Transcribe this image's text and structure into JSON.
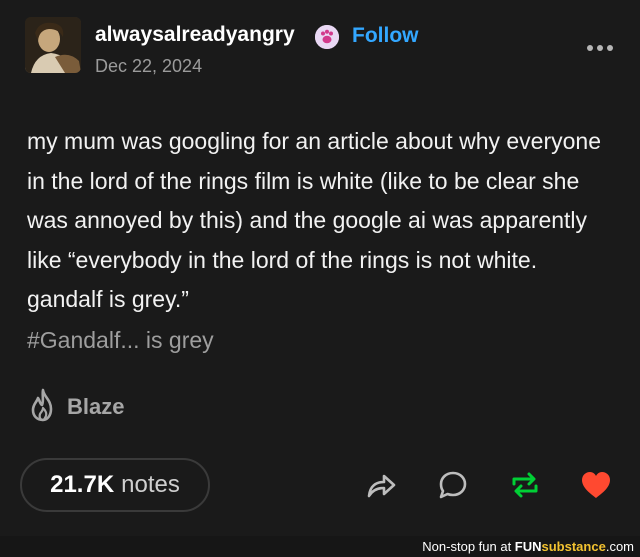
{
  "post": {
    "username": "alwaysalreadyangry",
    "follow_label": "Follow",
    "date": "Dec 22, 2024",
    "body": "my mum was googling for an article about why everyone in the lord of the rings film is white (like to be clear she was annoyed by this) and the google ai was apparently like “everybody in the lord of the rings is not white. gandalf is grey.”",
    "tag": "#Gandalf... is grey",
    "blaze_label": "Blaze",
    "notes_count": "21.7K",
    "notes_label": "notes"
  },
  "icons": {
    "badge": "paw-badge-icon",
    "more": "more-options-icon",
    "blaze": "flame-icon",
    "share": "share-icon",
    "reply": "reply-icon",
    "reblog": "reblog-icon",
    "like": "heart-icon"
  },
  "colors": {
    "follow": "#33a7ff",
    "reblog": "#00cf35",
    "like": "#ff4930",
    "background": "#1a1a1a"
  },
  "watermark": {
    "prefix": "Non-stop fun at ",
    "brand_fun": "FUN",
    "brand_sub": "substance",
    "suffix": ".com"
  }
}
